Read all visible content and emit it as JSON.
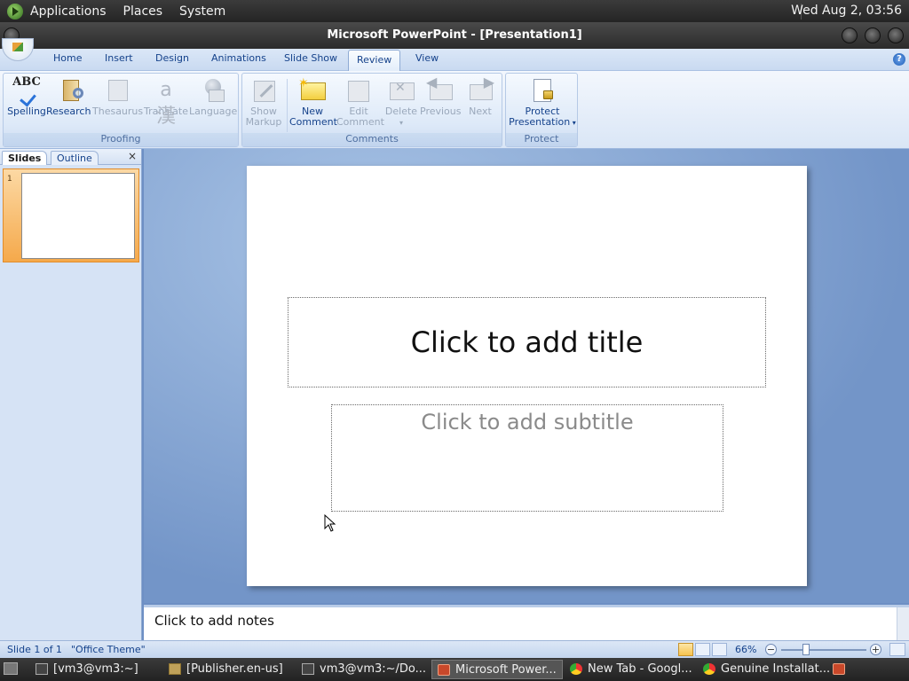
{
  "gnome_panel": {
    "menus": [
      "Applications",
      "Places",
      "System"
    ],
    "clock": "Wed Aug  2, 03:56"
  },
  "window": {
    "title": "Microsoft PowerPoint - [Presentation1]"
  },
  "ribbon": {
    "tabs": [
      "Home",
      "Insert",
      "Design",
      "Animations",
      "Slide Show",
      "Review",
      "View"
    ],
    "active_tab": "Review",
    "groups": {
      "proofing": {
        "label": "Proofing",
        "buttons": [
          "Spelling",
          "Research",
          "Thesaurus",
          "Translate",
          "Language"
        ]
      },
      "comments": {
        "label": "Comments",
        "show_markup": [
          "Show",
          "Markup"
        ],
        "new_comment": [
          "New",
          "Comment"
        ],
        "edit_comment": [
          "Edit",
          "Comment"
        ],
        "delete": "Delete",
        "previous": "Previous",
        "next": "Next"
      },
      "protect": {
        "label": "Protect",
        "protect_presentation": [
          "Protect",
          "Presentation"
        ]
      }
    }
  },
  "left_pane": {
    "tabs": [
      "Slides",
      "Outline"
    ],
    "active_tab": "Slides",
    "thumbnail_number": "1"
  },
  "slide": {
    "title_placeholder": "Click to add title",
    "subtitle_placeholder": "Click to add subtitle"
  },
  "notes": {
    "placeholder": "Click to add notes"
  },
  "status_bar": {
    "slide_indicator": "Slide 1 of 1",
    "theme": "\"Office Theme\"",
    "zoom": "66%"
  },
  "taskbar": {
    "items": [
      "[vm3@vm3:~]",
      "[Publisher.en-us]",
      "vm3@vm3:~/Do...",
      "Microsoft Power...",
      "New Tab - Googl...",
      "Genuine Installat..."
    ],
    "active_index": 3
  },
  "colors": {
    "ribbon_text": "#15428b",
    "workspace_bg": "#7395c8",
    "selected_thumb": "#f5a94b"
  }
}
